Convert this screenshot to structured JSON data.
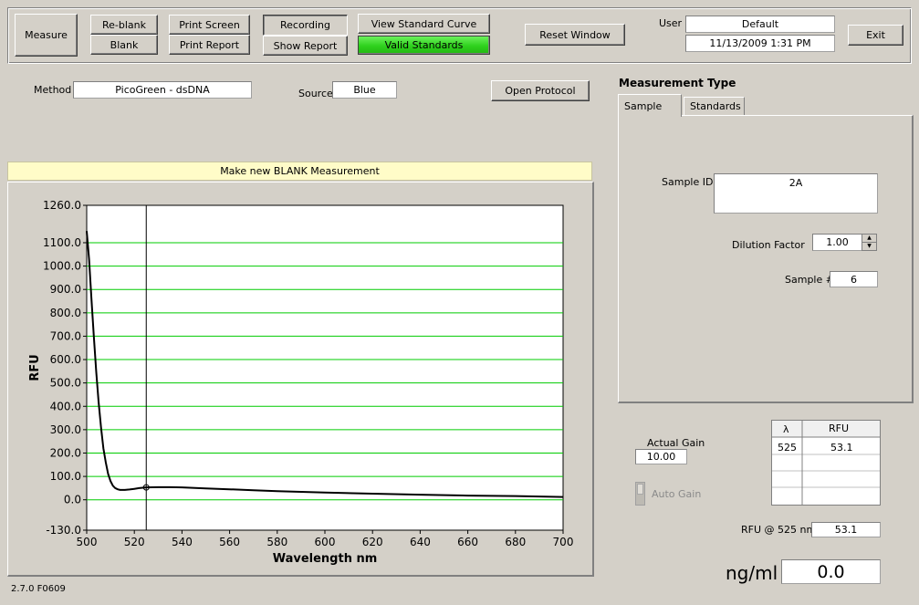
{
  "toolbar": {
    "measure": "Measure",
    "reblank": "Re-blank",
    "blank": "Blank",
    "print_screen": "Print Screen",
    "print_report": "Print Report",
    "recording": "Recording",
    "show_report": "Show Report",
    "view_standard_curve": "View Standard Curve",
    "valid_standards": "Valid Standards",
    "reset_window": "Reset Window",
    "exit": "Exit",
    "user_label": "User",
    "user_value": "Default",
    "datetime": "11/13/2009  1:31 PM"
  },
  "method": {
    "label": "Method",
    "value": "PicoGreen - dsDNA",
    "source_label": "Source",
    "source_value": "Blue",
    "open_protocol": "Open Protocol"
  },
  "banner": "Make new BLANK Measurement",
  "measurement_type": {
    "title": "Measurement Type",
    "tabs": [
      "Sample",
      "Standards"
    ],
    "sample_id_label": "Sample ID",
    "sample_id_value": "2A",
    "dilution_label": "Dilution Factor",
    "dilution_value": "1.00",
    "sample_num_label": "Sample #",
    "sample_num_value": "6"
  },
  "gain": {
    "actual_gain_label": "Actual Gain",
    "actual_gain_value": "10.00",
    "auto_gain_label": "Auto Gain"
  },
  "rfu_table": {
    "headers": [
      "λ",
      "RFU"
    ],
    "rows": [
      [
        "525",
        "53.1"
      ]
    ]
  },
  "rfu_at": {
    "label": "RFU @ 525 nm",
    "value": "53.1"
  },
  "result": {
    "unit": "ng/ml",
    "value": "0.0"
  },
  "version": "2.7.0 F0609",
  "colors": {
    "background": "#d4d0c8",
    "grid": "#00cc00",
    "trace": "#000000",
    "banner": "#fffcc8",
    "valid_standards": "#2fd11d"
  },
  "chart_data": {
    "type": "line",
    "xlabel": "Wavelength  nm",
    "ylabel": "RFU",
    "xlim": [
      500,
      700
    ],
    "ylim": [
      -130,
      1260
    ],
    "x_ticks": [
      500,
      520,
      540,
      560,
      580,
      600,
      620,
      640,
      660,
      680,
      700
    ],
    "y_ticks": [
      "-130.0",
      "0.0",
      "100.0",
      "200.0",
      "300.0",
      "400.0",
      "500.0",
      "600.0",
      "700.0",
      "800.0",
      "900.0",
      "1000.0",
      "1100.0",
      "1260.0"
    ],
    "y_tick_values": [
      -130,
      0,
      100,
      200,
      300,
      400,
      500,
      600,
      700,
      800,
      900,
      1000,
      1100,
      1260
    ],
    "cursor_x": 525,
    "grid": true,
    "series": [
      {
        "x": [
          500,
          501,
          502,
          503,
          504,
          505,
          506,
          507,
          508,
          509,
          510,
          511,
          512,
          513,
          514,
          516,
          518,
          520,
          522,
          525,
          530,
          535,
          540,
          550,
          560,
          570,
          580,
          600,
          620,
          640,
          660,
          680,
          700
        ],
        "values": [
          1150,
          1030,
          860,
          700,
          550,
          420,
          310,
          220,
          160,
          110,
          80,
          60,
          50,
          45,
          42,
          42,
          44,
          47,
          50,
          53,
          54,
          54,
          53,
          49,
          45,
          41,
          37,
          31,
          26,
          22,
          18,
          16,
          12
        ]
      }
    ]
  }
}
